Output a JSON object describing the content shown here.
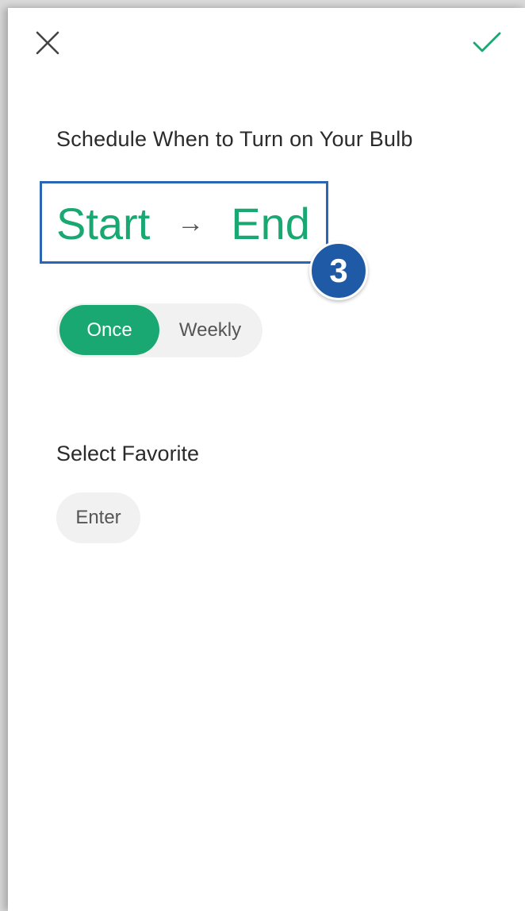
{
  "header": {
    "close_icon": "close-icon",
    "confirm_icon": "checkmark-icon",
    "confirm_color": "#1aa872"
  },
  "schedule": {
    "heading": "Schedule When to Turn on Your Bulb",
    "start_label": "Start",
    "arrow": "→",
    "end_label": "End",
    "accent_color": "#1aa872"
  },
  "annotation": {
    "badge_number": "3",
    "highlight_color": "#2a66b3"
  },
  "repeat": {
    "options": [
      "Once",
      "Weekly"
    ],
    "selected": "Once"
  },
  "favorite": {
    "label": "Select Favorite",
    "enter_label": "Enter"
  }
}
